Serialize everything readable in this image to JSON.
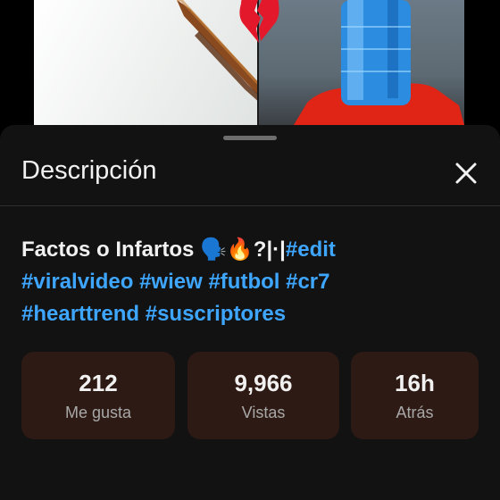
{
  "video": {
    "left_art": "burnt-stick-image",
    "right_art": "water-bottle-image",
    "center_icon": "broken-heart-icon"
  },
  "sheet": {
    "title": "Descripción",
    "close_icon": "close-icon"
  },
  "description": {
    "title_text": "Factos o Infartos",
    "emoji": "🗣️🔥",
    "symbols": "?|·|",
    "hashtags": [
      "#edit",
      "#viralvideo",
      "#wiew",
      "#futbol",
      "#cr7",
      "#hearttrend",
      "#suscriptores"
    ]
  },
  "stats": [
    {
      "value": "212",
      "label": "Me gusta"
    },
    {
      "value": "9,966",
      "label": "Vistas"
    },
    {
      "value": "16h",
      "label": "Atrás"
    }
  ],
  "colors": {
    "accent": "#3ea6ff",
    "card": "#2e1a14",
    "sheet": "#121212"
  }
}
